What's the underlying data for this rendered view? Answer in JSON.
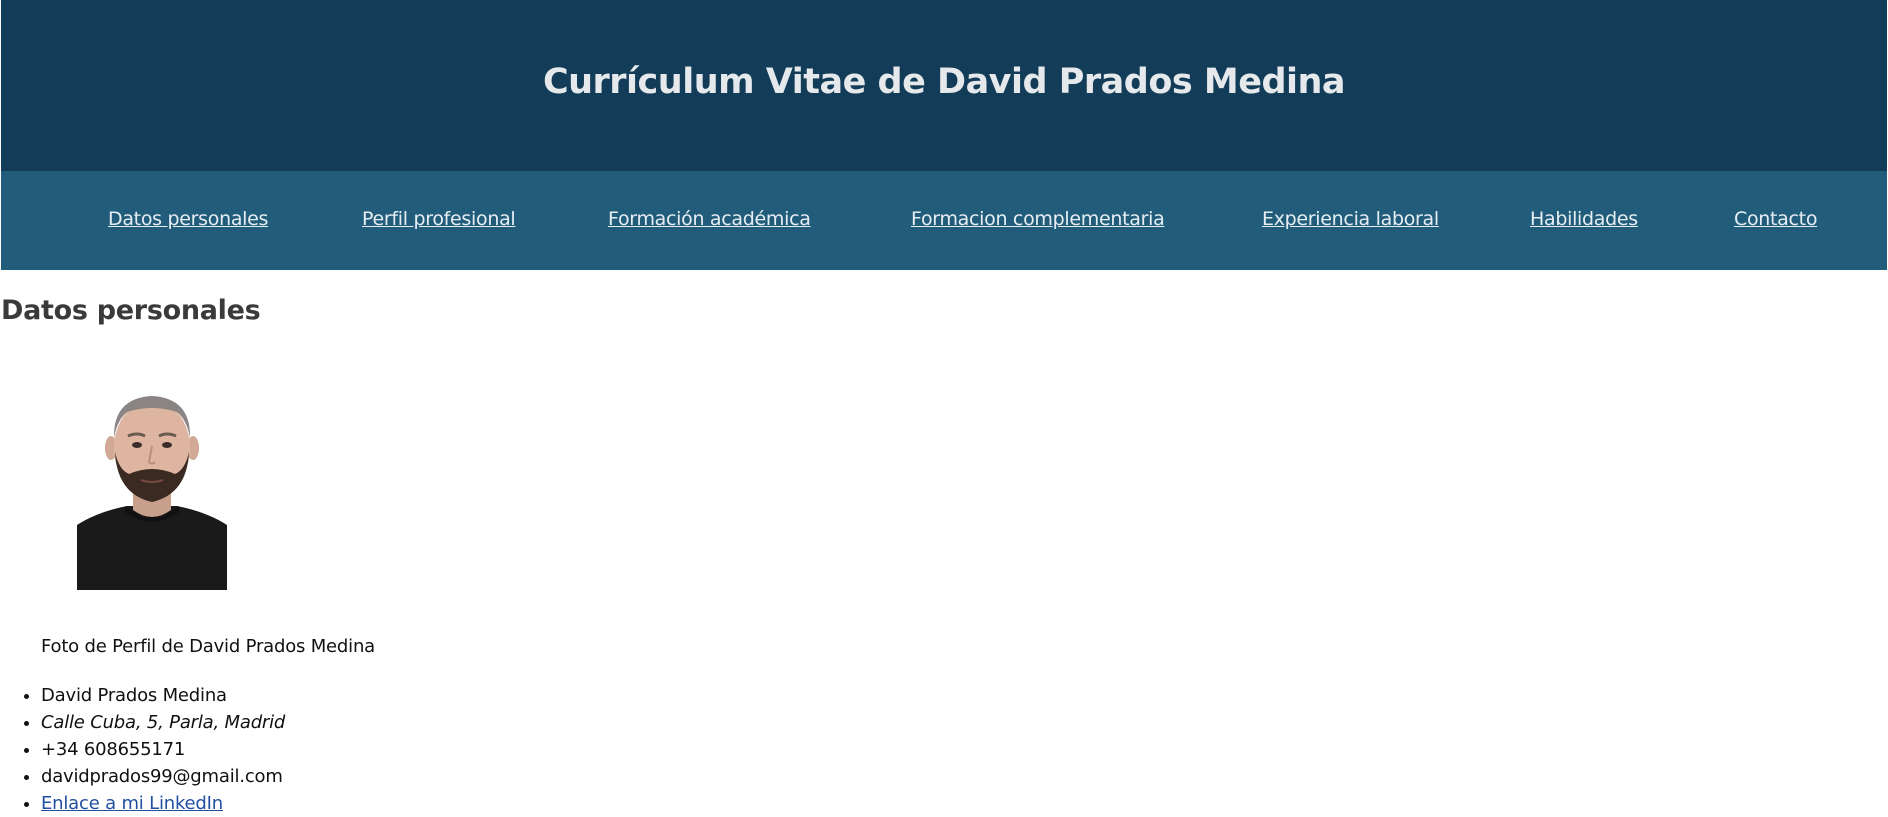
{
  "header": {
    "title": "Currículum Vitae de David Prados Medina"
  },
  "nav": {
    "items": [
      {
        "label": "Datos personales"
      },
      {
        "label": "Perfil profesional"
      },
      {
        "label": "Formación académica"
      },
      {
        "label": "Formacion complementaria"
      },
      {
        "label": "Experiencia laboral"
      },
      {
        "label": "Habilidades"
      },
      {
        "label": "Contacto"
      }
    ]
  },
  "section": {
    "title": "Datos personales",
    "photo_caption": "Foto de Perfil de David Prados Medina",
    "details": {
      "name": "David Prados Medina",
      "address": "Calle Cuba, 5, Parla, Madrid",
      "phone": "+34 608655171",
      "email": "davidprados99@gmail.com",
      "linkedin_label": "Enlace a mi LinkedIn"
    }
  },
  "colors": {
    "header_bg": "#123c57",
    "nav_bg": "#215d7b",
    "link": "#2150a0"
  }
}
